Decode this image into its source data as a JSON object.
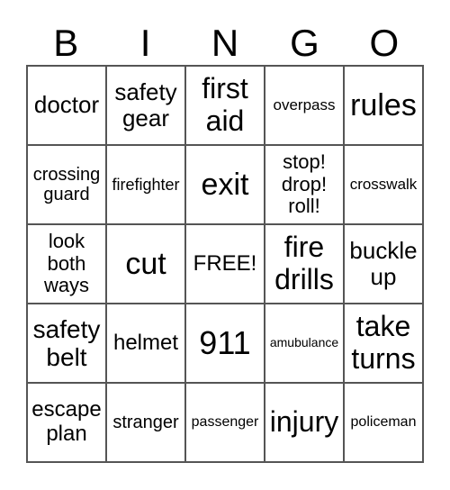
{
  "header": [
    "B",
    "I",
    "N",
    "G",
    "O"
  ],
  "cells": [
    "doctor",
    "safety gear",
    "first aid",
    "overpass",
    "rules",
    "crossing guard",
    "firefighter",
    "exit",
    "stop! drop! roll!",
    "crosswalk",
    "look both ways",
    "cut",
    "FREE!",
    "fire drills",
    "buckle up",
    "safety belt",
    "helmet",
    "911",
    "amubulance",
    "take turns",
    "escape plan",
    "stranger",
    "passenger",
    "injury",
    "policeman"
  ]
}
